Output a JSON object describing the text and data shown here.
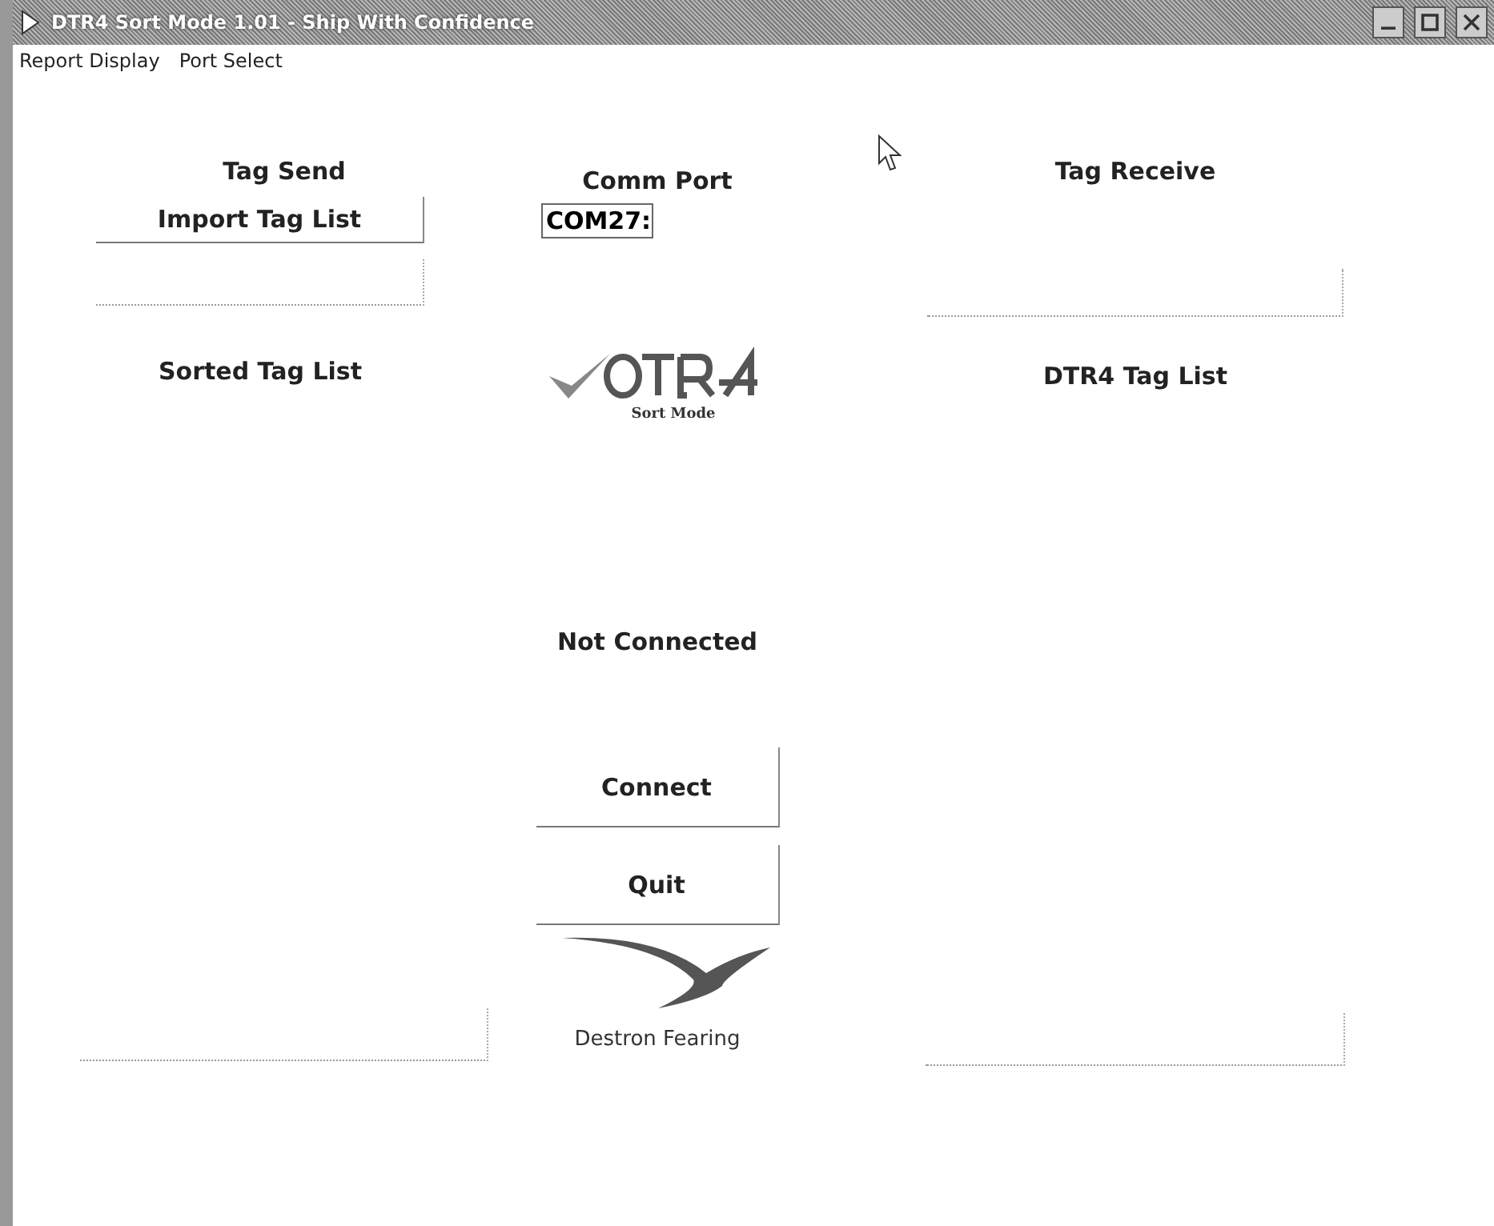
{
  "window": {
    "title": "DTR4 Sort Mode 1.01 - Ship With Confidence"
  },
  "menu": [
    {
      "label": "Report Display"
    },
    {
      "label": "Port Select"
    }
  ],
  "tag_send": {
    "title": "Tag Send",
    "buttons": [
      {
        "label": "Import Tag List",
        "disabled": false
      },
      {
        "disabled": true
      }
    ],
    "list_title": "Sorted Tag List",
    "bottom_button": {
      "disabled": true
    }
  },
  "center": {
    "comm_port_label": "Comm Port",
    "comm_port": "COM27:",
    "logo_subtitle": "Sort Mode",
    "status": "Not Connected",
    "buttons": [
      {
        "label": "Connect",
        "disabled": false
      },
      {
        "label": "Quit",
        "disabled": false
      }
    ],
    "company": "Destron Fearing"
  },
  "tag_receive": {
    "title": "Tag Receive",
    "buttons": [
      {
        "disabled": true
      }
    ],
    "list_title": "DTR4 Tag List",
    "bottom_button": {
      "disabled": true
    }
  }
}
